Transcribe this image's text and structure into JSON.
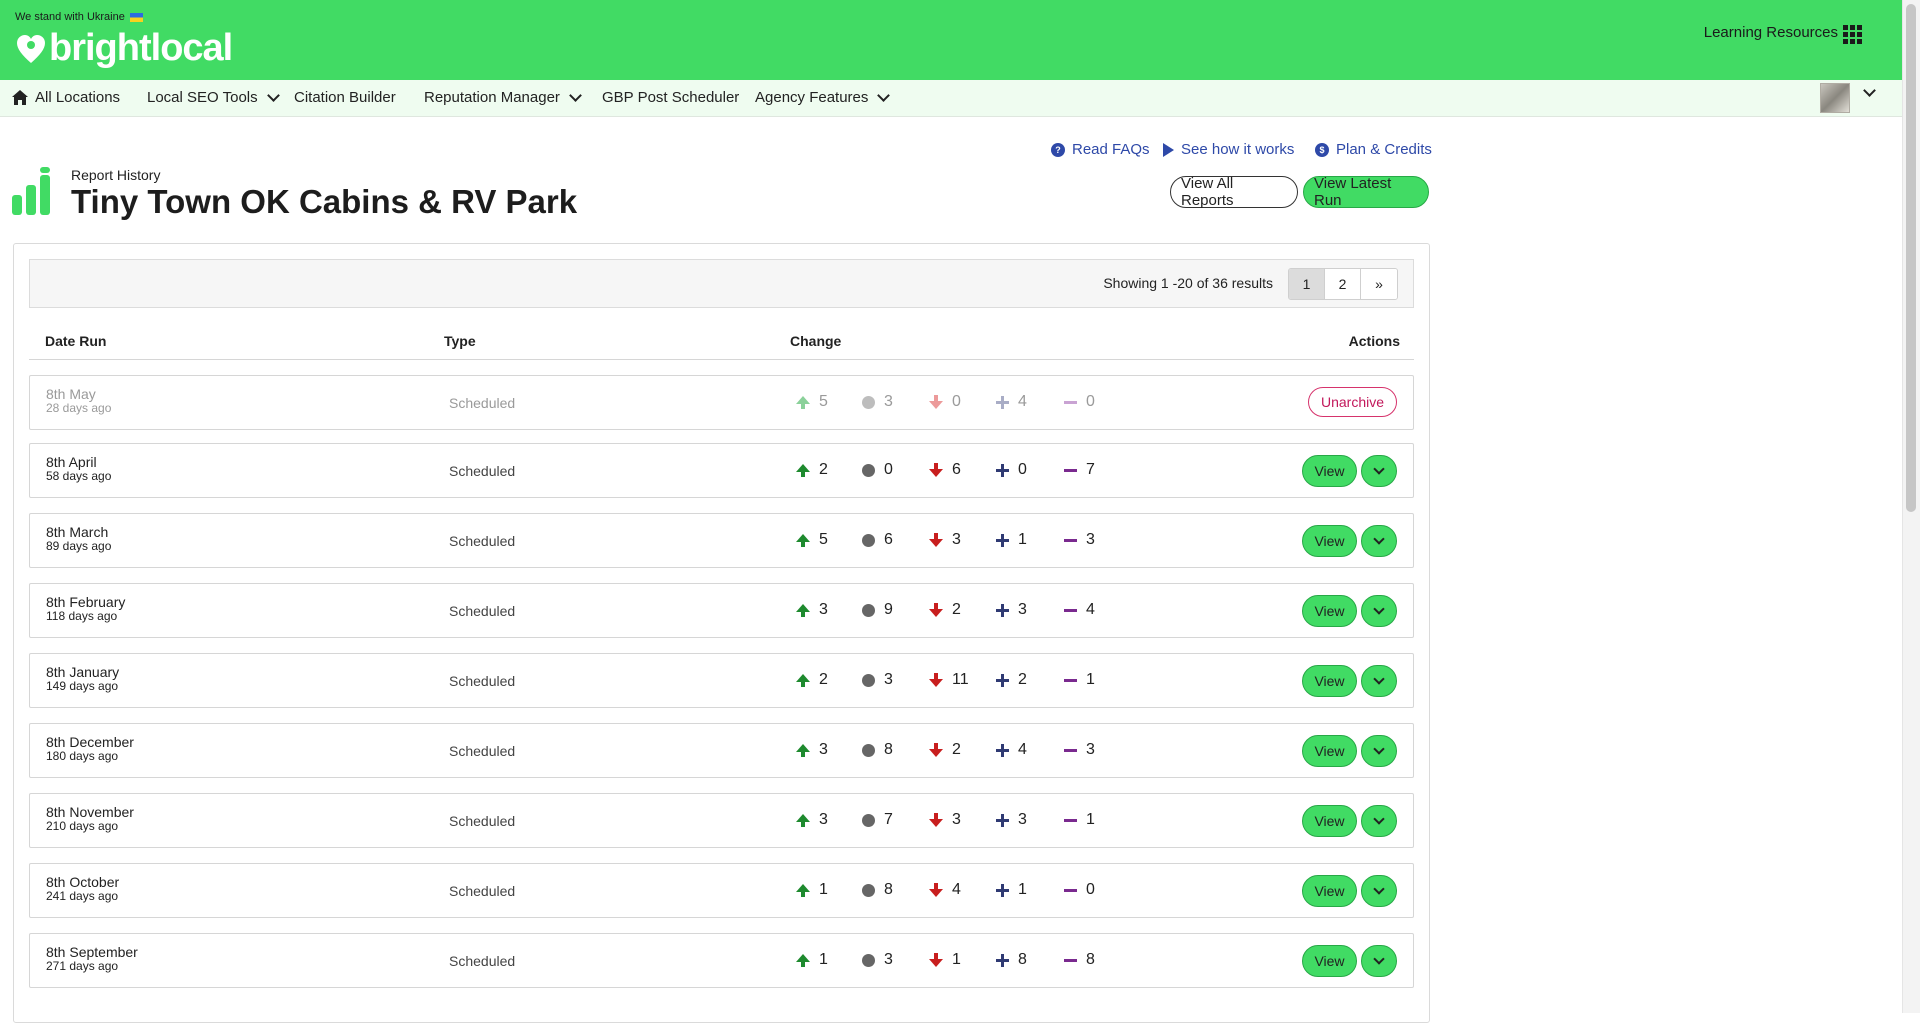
{
  "banner": {
    "ukraine_text": "We stand with Ukraine",
    "brand": "brightlocal",
    "learning_resources": "Learning Resources"
  },
  "nav": {
    "items": [
      {
        "label": "All Locations"
      },
      {
        "label": "Local SEO Tools"
      },
      {
        "label": "Citation Builder"
      },
      {
        "label": "Reputation Manager"
      },
      {
        "label": "GBP Post Scheduler"
      },
      {
        "label": "Agency Features"
      }
    ]
  },
  "help_links": {
    "faqs": "Read FAQs",
    "how": "See how it works",
    "plan": "Plan & Credits"
  },
  "header": {
    "subtitle": "Report History",
    "title": "Tiny Town OK Cabins & RV Park",
    "view_all": "View All Reports",
    "view_latest": "View Latest Run"
  },
  "results": {
    "showing": "Showing 1 -20 of 36 results",
    "pages": [
      "1",
      "2",
      "»"
    ]
  },
  "table": {
    "headers": {
      "date": "Date Run",
      "type": "Type",
      "change": "Change",
      "actions": "Actions"
    },
    "rows": [
      {
        "date": "8th May",
        "ago": "28 days ago",
        "type": "Scheduled",
        "up": "5",
        "same": "3",
        "down": "0",
        "new": "4",
        "lost": "0",
        "action": "Unarchive"
      },
      {
        "date": "8th April",
        "ago": "58 days ago",
        "type": "Scheduled",
        "up": "2",
        "same": "0",
        "down": "6",
        "new": "0",
        "lost": "7",
        "action": "View"
      },
      {
        "date": "8th March",
        "ago": "89 days ago",
        "type": "Scheduled",
        "up": "5",
        "same": "6",
        "down": "3",
        "new": "1",
        "lost": "3",
        "action": "View"
      },
      {
        "date": "8th February",
        "ago": "118 days ago",
        "type": "Scheduled",
        "up": "3",
        "same": "9",
        "down": "2",
        "new": "3",
        "lost": "4",
        "action": "View"
      },
      {
        "date": "8th January",
        "ago": "149 days ago",
        "type": "Scheduled",
        "up": "2",
        "same": "3",
        "down": "11",
        "new": "2",
        "lost": "1",
        "action": "View"
      },
      {
        "date": "8th December",
        "ago": "180 days ago",
        "type": "Scheduled",
        "up": "3",
        "same": "8",
        "down": "2",
        "new": "4",
        "lost": "3",
        "action": "View"
      },
      {
        "date": "8th November",
        "ago": "210 days ago",
        "type": "Scheduled",
        "up": "3",
        "same": "7",
        "down": "3",
        "new": "3",
        "lost": "1",
        "action": "View"
      },
      {
        "date": "8th October",
        "ago": "241 days ago",
        "type": "Scheduled",
        "up": "1",
        "same": "8",
        "down": "4",
        "new": "1",
        "lost": "0",
        "action": "View"
      },
      {
        "date": "8th September",
        "ago": "271 days ago",
        "type": "Scheduled",
        "up": "1",
        "same": "3",
        "down": "1",
        "new": "8",
        "lost": "8",
        "action": "View"
      }
    ]
  },
  "colors": {
    "brand_green": "#41db64",
    "link_blue": "#2e49a8",
    "up": "#1e8a2e",
    "down": "#c81e1e",
    "archive_pink": "#d6336c"
  }
}
